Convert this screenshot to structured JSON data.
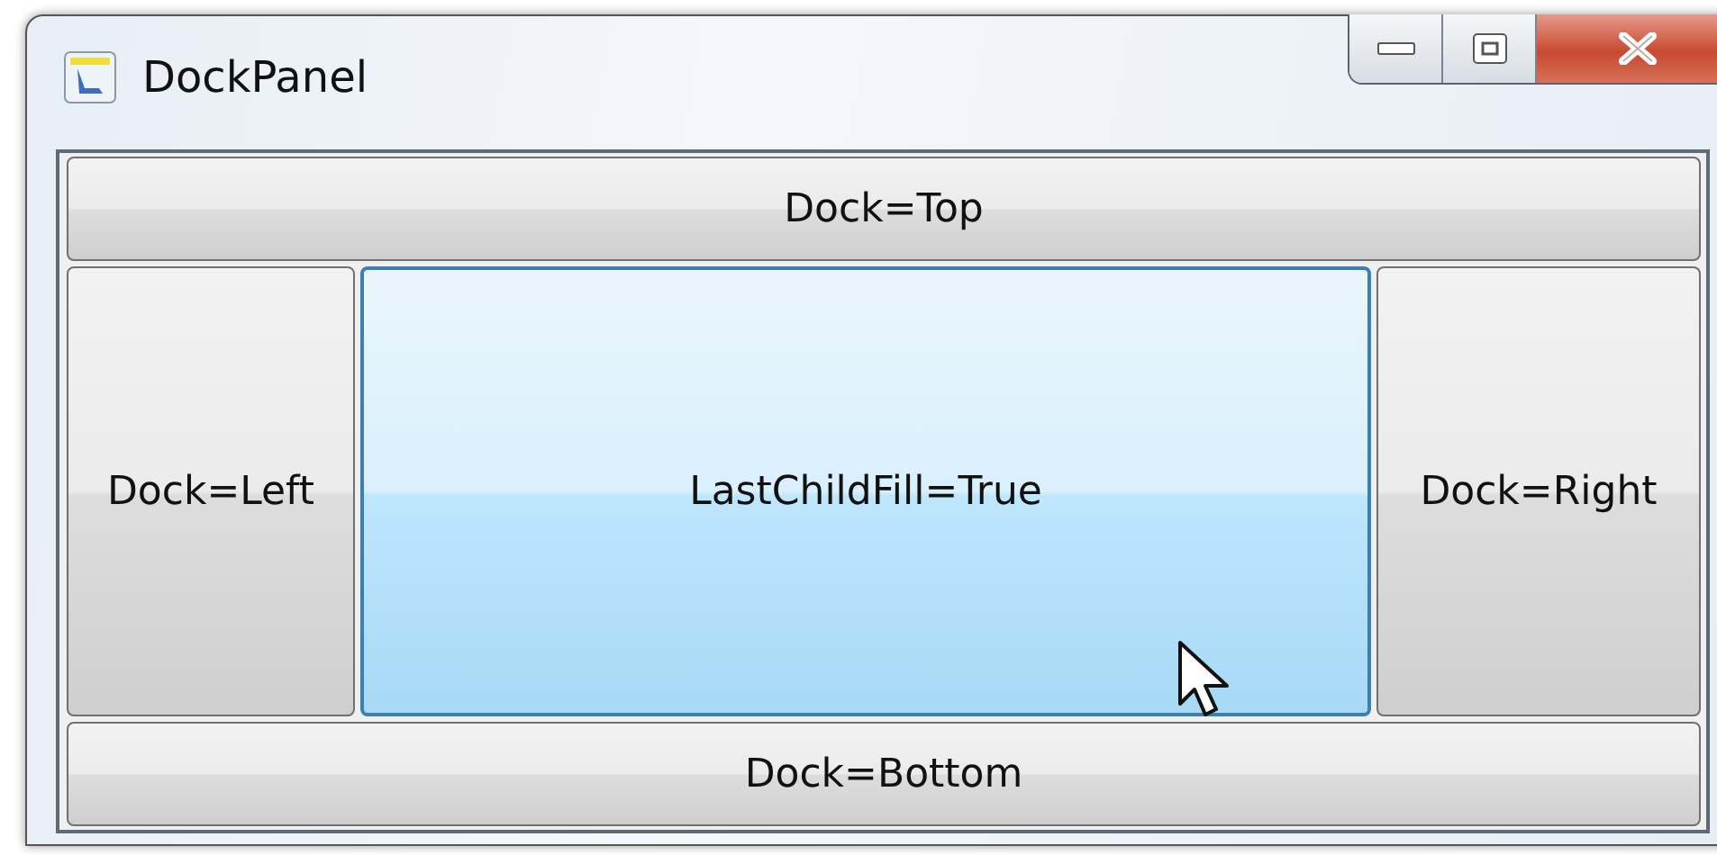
{
  "window": {
    "title": "DockPanel"
  },
  "buttons": [
    {
      "kind": "top",
      "label": "Dock=Top",
      "hovered": false
    },
    {
      "kind": "left",
      "label": "Dock=Left",
      "hovered": false
    },
    {
      "kind": "fill",
      "label": "LastChildFill=True",
      "hovered": true
    },
    {
      "kind": "right",
      "label": "Dock=Right",
      "hovered": false
    },
    {
      "kind": "bottom",
      "label": "Dock=Bottom",
      "hovered": false
    }
  ]
}
